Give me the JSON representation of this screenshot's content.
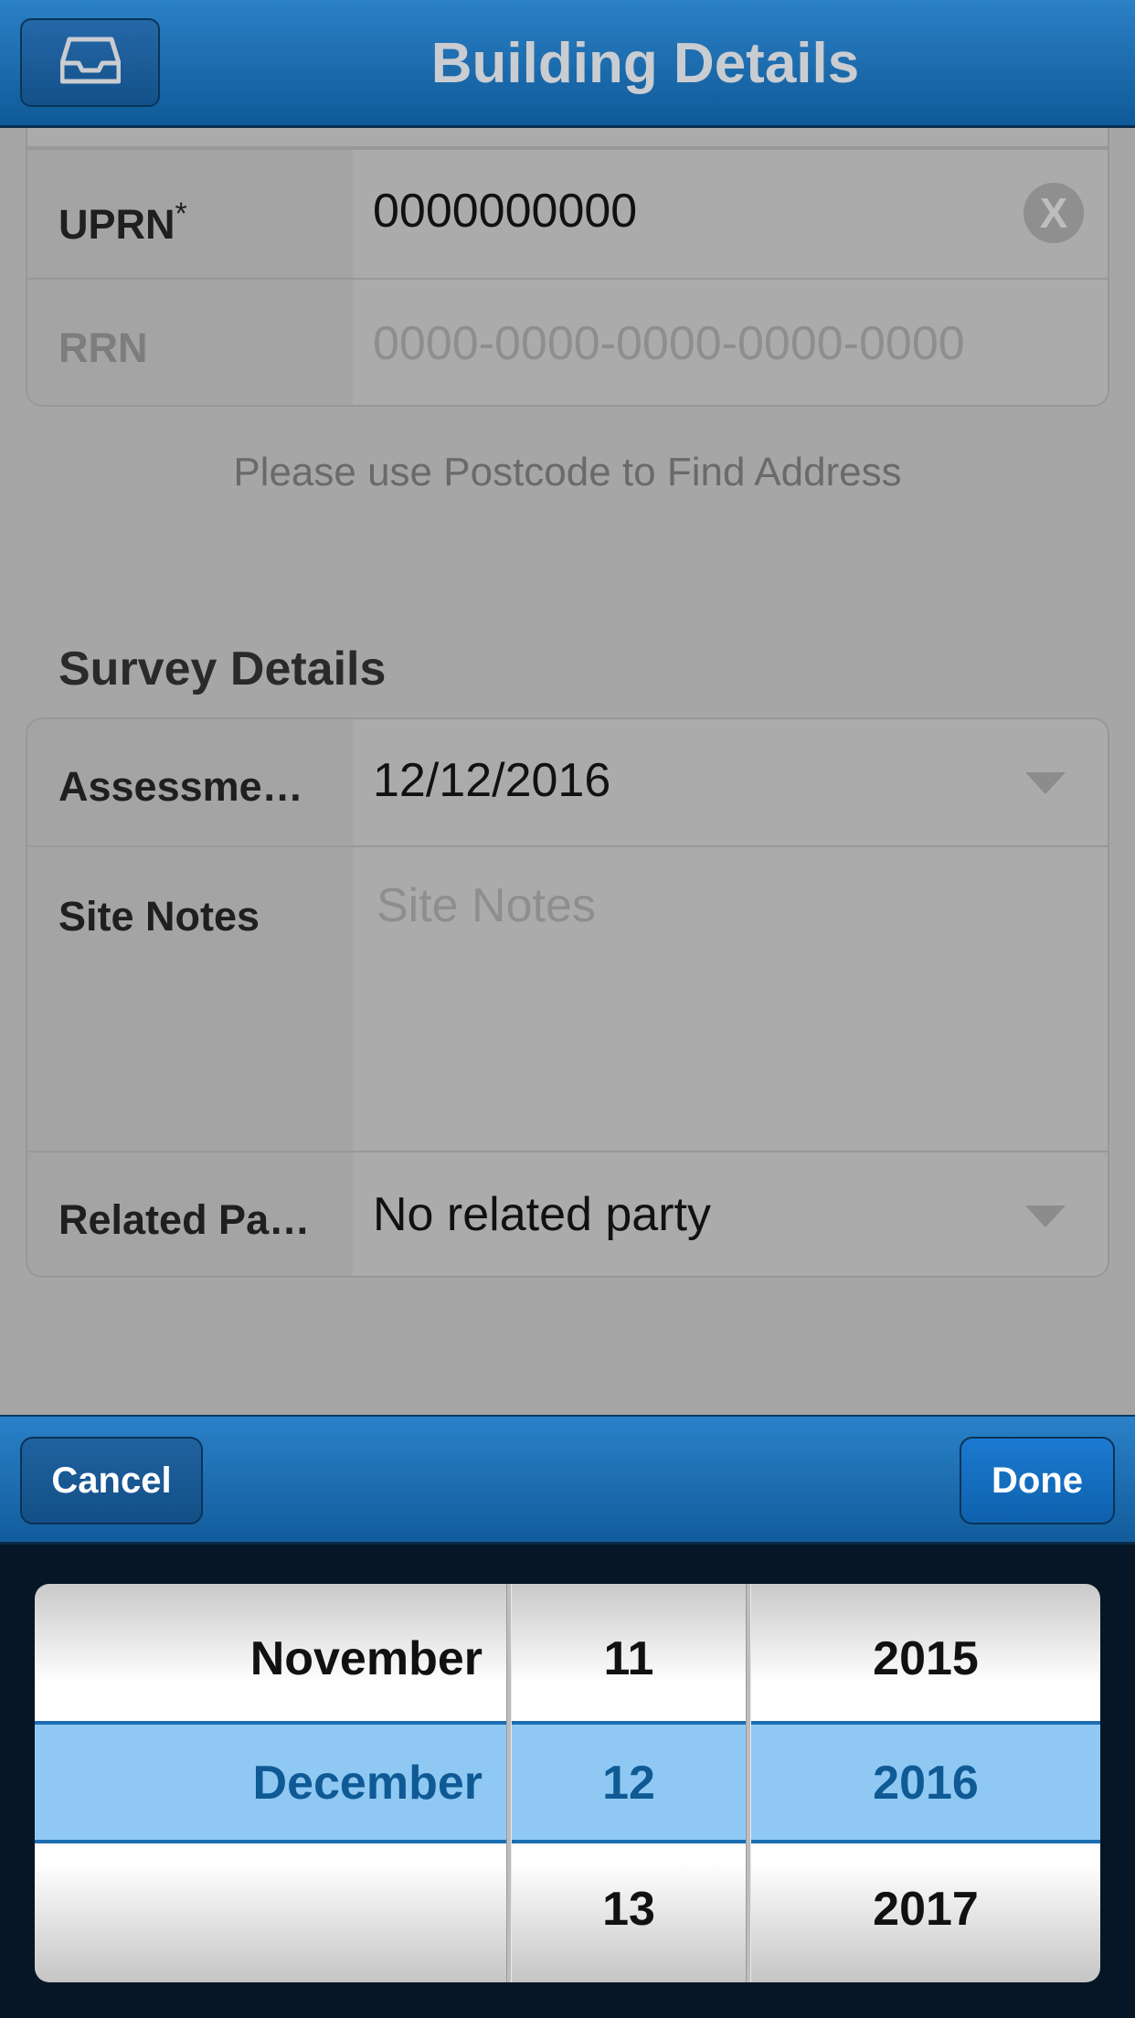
{
  "nav": {
    "title": "Building Details",
    "left_icon": "inbox-icon"
  },
  "address": {
    "rows": [
      {
        "label": "UPRN",
        "required_mark": "*",
        "value": "0000000000",
        "clear_icon": "clear-icon",
        "clear_glyph": "X"
      },
      {
        "label": "RRN",
        "placeholder": "0000-0000-0000-0000-0000"
      }
    ],
    "hint": "Please use Postcode to Find Address"
  },
  "survey": {
    "section_title": "Survey Details",
    "rows": [
      {
        "label": "Assessme…",
        "value": "12/12/2016",
        "icon": "dropdown-caret-icon"
      },
      {
        "label": "Site Notes",
        "placeholder": "Site Notes"
      },
      {
        "label": "Related Pa…",
        "value": "No related party",
        "icon": "dropdown-caret-icon"
      }
    ]
  },
  "toolbar": {
    "cancel_label": "Cancel",
    "done_label": "Done"
  },
  "date_picker": {
    "months": [
      "November",
      "December",
      ""
    ],
    "days": [
      "11",
      "12",
      "13"
    ],
    "years": [
      "2015",
      "2016",
      "2017"
    ],
    "selected_index": 1,
    "colors": {
      "selection": "#6fbaf0",
      "selected_text": "#0f5a94"
    }
  }
}
